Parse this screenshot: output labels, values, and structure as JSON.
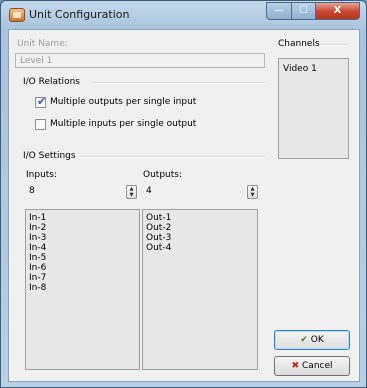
{
  "window": {
    "title": "Unit Configuration",
    "caption": {
      "minimize": "—",
      "maximize": "☐",
      "close": "X"
    }
  },
  "unit": {
    "name_label": "Unit Name:",
    "name_value": "Level 1"
  },
  "io_relations": {
    "heading": "I/O Relations",
    "multiple_outputs": {
      "label": "Multiple outputs per single input",
      "checked": true
    },
    "multiple_inputs": {
      "label": "Multiple inputs per single output",
      "checked": false
    }
  },
  "io_settings": {
    "heading": "I/O Settings",
    "inputs_label": "Inputs:",
    "inputs_value": "8",
    "outputs_label": "Outputs:",
    "outputs_value": "4",
    "inputs_list": [
      "In-1",
      "In-2",
      "In-3",
      "In-4",
      "In-5",
      "In-6",
      "In-7",
      "In-8"
    ],
    "outputs_list": [
      "Out-1",
      "Out-2",
      "Out-3",
      "Out-4"
    ]
  },
  "channels": {
    "heading": "Channels",
    "items": [
      "Video 1"
    ]
  },
  "buttons": {
    "ok": "OK",
    "cancel": "Cancel"
  },
  "icons": {
    "ok": "check-icon",
    "cancel": "x-icon",
    "app": "app-icon"
  }
}
